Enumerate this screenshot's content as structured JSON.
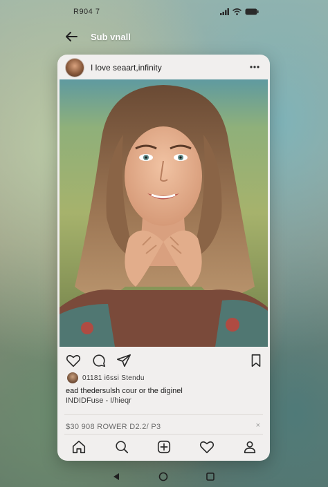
{
  "status_bar": {
    "time": "R904 7",
    "icons": [
      "signal-icon",
      "wifi-icon",
      "battery-icon"
    ]
  },
  "header": {
    "title": "Sub vnall",
    "back_icon": "back-arrow-icon"
  },
  "post": {
    "username": "I love seaart,infinity",
    "more_icon": "more-dots-icon",
    "actions": [
      "heart-icon",
      "comment-icon",
      "share-icon",
      "bookmark-icon"
    ],
    "likes_text": "01181 i6ssi Stendu",
    "caption": "ead thedersulsh cour or the diginel",
    "caption_sub": "INDIDFuse - I/hieqr",
    "promo": "$30 908 ROWER D2.2/ P3",
    "promo_close": "×"
  },
  "bottom_nav": [
    "home-icon",
    "search-icon",
    "add-post-icon",
    "activity-heart-icon",
    "profile-icon"
  ],
  "system_nav": [
    "back-triangle-icon",
    "home-circle-icon",
    "recents-square-icon"
  ],
  "colors": {
    "card_bg": "#f1efee",
    "text_primary": "#1b1b1b",
    "icon": "#2b2b2b"
  }
}
